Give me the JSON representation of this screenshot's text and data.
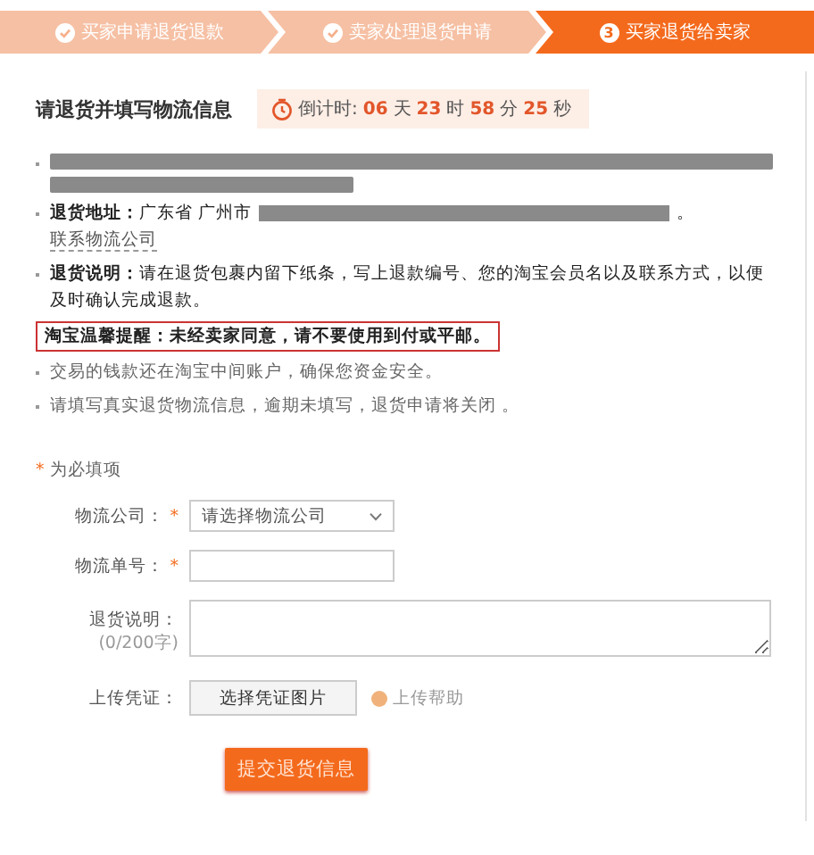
{
  "steps": [
    {
      "label": "买家申请退货退款",
      "done": true,
      "selected": false
    },
    {
      "label": "卖家处理退货申请",
      "done": true,
      "selected": false
    },
    {
      "number": "3",
      "label": "买家退货给卖家",
      "done": false,
      "selected": true
    }
  ],
  "header": {
    "title": "请退货并填写物流信息",
    "countdown": {
      "label": "倒计时:",
      "parts": [
        {
          "value": "06",
          "unit": "天"
        },
        {
          "value": "23",
          "unit": "时"
        },
        {
          "value": "58",
          "unit": "分"
        },
        {
          "value": "25",
          "unit": "秒"
        }
      ]
    }
  },
  "notices": [
    {
      "kind": "redacted"
    },
    {
      "kind": "address",
      "label": "退货地址：",
      "text": "广东省 广州市",
      "end": "。",
      "link": "联系物流公司"
    },
    {
      "kind": "info",
      "label": "退货说明：",
      "text": "请在退货包裹内留下纸条，写上退款编号、您的淘宝会员名以及联系方式，以便及时确认完成退款。"
    },
    {
      "kind": "warning",
      "label": "淘宝温馨提醒：",
      "text": "未经卖家同意，请不要使用到付或平邮。"
    },
    {
      "kind": "plain",
      "text": "交易的钱款还在淘宝中间账户，确保您资金安全。"
    },
    {
      "kind": "plain",
      "text": "请填写真实退货物流信息，逾期未填写，退货申请将关闭 。"
    }
  ],
  "form": {
    "required_note": {
      "mark": "*",
      "text": "为必填项"
    },
    "fields": [
      {
        "kind": "select",
        "label": "物流公司：",
        "required": true,
        "placeholder": "请选择物流公司"
      },
      {
        "kind": "input",
        "label": "物流单号：",
        "required": true
      },
      {
        "kind": "textarea",
        "label": "退货说明：",
        "counter": "(0/200字)",
        "required": false
      },
      {
        "kind": "upload",
        "label": "上传凭证：",
        "required": false,
        "button": "选择凭证图片",
        "help": "上传帮助"
      }
    ],
    "submit": "提交退货信息"
  }
}
